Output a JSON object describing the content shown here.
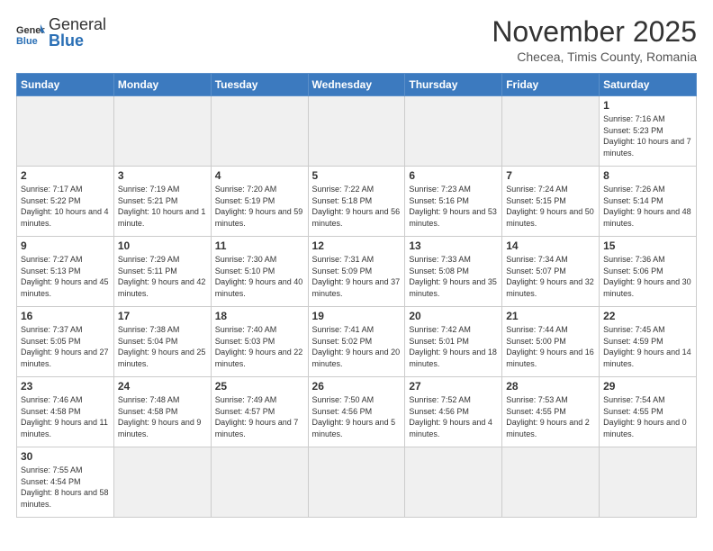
{
  "header": {
    "logo_general": "General",
    "logo_blue": "Blue",
    "month_title": "November 2025",
    "location": "Checea, Timis County, Romania"
  },
  "weekdays": [
    "Sunday",
    "Monday",
    "Tuesday",
    "Wednesday",
    "Thursday",
    "Friday",
    "Saturday"
  ],
  "weeks": [
    [
      {
        "day": "",
        "info": ""
      },
      {
        "day": "",
        "info": ""
      },
      {
        "day": "",
        "info": ""
      },
      {
        "day": "",
        "info": ""
      },
      {
        "day": "",
        "info": ""
      },
      {
        "day": "",
        "info": ""
      },
      {
        "day": "1",
        "info": "Sunrise: 7:16 AM\nSunset: 5:23 PM\nDaylight: 10 hours and 7 minutes."
      }
    ],
    [
      {
        "day": "2",
        "info": "Sunrise: 7:17 AM\nSunset: 5:22 PM\nDaylight: 10 hours and 4 minutes."
      },
      {
        "day": "3",
        "info": "Sunrise: 7:19 AM\nSunset: 5:21 PM\nDaylight: 10 hours and 1 minute."
      },
      {
        "day": "4",
        "info": "Sunrise: 7:20 AM\nSunset: 5:19 PM\nDaylight: 9 hours and 59 minutes."
      },
      {
        "day": "5",
        "info": "Sunrise: 7:22 AM\nSunset: 5:18 PM\nDaylight: 9 hours and 56 minutes."
      },
      {
        "day": "6",
        "info": "Sunrise: 7:23 AM\nSunset: 5:16 PM\nDaylight: 9 hours and 53 minutes."
      },
      {
        "day": "7",
        "info": "Sunrise: 7:24 AM\nSunset: 5:15 PM\nDaylight: 9 hours and 50 minutes."
      },
      {
        "day": "8",
        "info": "Sunrise: 7:26 AM\nSunset: 5:14 PM\nDaylight: 9 hours and 48 minutes."
      }
    ],
    [
      {
        "day": "9",
        "info": "Sunrise: 7:27 AM\nSunset: 5:13 PM\nDaylight: 9 hours and 45 minutes."
      },
      {
        "day": "10",
        "info": "Sunrise: 7:29 AM\nSunset: 5:11 PM\nDaylight: 9 hours and 42 minutes."
      },
      {
        "day": "11",
        "info": "Sunrise: 7:30 AM\nSunset: 5:10 PM\nDaylight: 9 hours and 40 minutes."
      },
      {
        "day": "12",
        "info": "Sunrise: 7:31 AM\nSunset: 5:09 PM\nDaylight: 9 hours and 37 minutes."
      },
      {
        "day": "13",
        "info": "Sunrise: 7:33 AM\nSunset: 5:08 PM\nDaylight: 9 hours and 35 minutes."
      },
      {
        "day": "14",
        "info": "Sunrise: 7:34 AM\nSunset: 5:07 PM\nDaylight: 9 hours and 32 minutes."
      },
      {
        "day": "15",
        "info": "Sunrise: 7:36 AM\nSunset: 5:06 PM\nDaylight: 9 hours and 30 minutes."
      }
    ],
    [
      {
        "day": "16",
        "info": "Sunrise: 7:37 AM\nSunset: 5:05 PM\nDaylight: 9 hours and 27 minutes."
      },
      {
        "day": "17",
        "info": "Sunrise: 7:38 AM\nSunset: 5:04 PM\nDaylight: 9 hours and 25 minutes."
      },
      {
        "day": "18",
        "info": "Sunrise: 7:40 AM\nSunset: 5:03 PM\nDaylight: 9 hours and 22 minutes."
      },
      {
        "day": "19",
        "info": "Sunrise: 7:41 AM\nSunset: 5:02 PM\nDaylight: 9 hours and 20 minutes."
      },
      {
        "day": "20",
        "info": "Sunrise: 7:42 AM\nSunset: 5:01 PM\nDaylight: 9 hours and 18 minutes."
      },
      {
        "day": "21",
        "info": "Sunrise: 7:44 AM\nSunset: 5:00 PM\nDaylight: 9 hours and 16 minutes."
      },
      {
        "day": "22",
        "info": "Sunrise: 7:45 AM\nSunset: 4:59 PM\nDaylight: 9 hours and 14 minutes."
      }
    ],
    [
      {
        "day": "23",
        "info": "Sunrise: 7:46 AM\nSunset: 4:58 PM\nDaylight: 9 hours and 11 minutes."
      },
      {
        "day": "24",
        "info": "Sunrise: 7:48 AM\nSunset: 4:58 PM\nDaylight: 9 hours and 9 minutes."
      },
      {
        "day": "25",
        "info": "Sunrise: 7:49 AM\nSunset: 4:57 PM\nDaylight: 9 hours and 7 minutes."
      },
      {
        "day": "26",
        "info": "Sunrise: 7:50 AM\nSunset: 4:56 PM\nDaylight: 9 hours and 5 minutes."
      },
      {
        "day": "27",
        "info": "Sunrise: 7:52 AM\nSunset: 4:56 PM\nDaylight: 9 hours and 4 minutes."
      },
      {
        "day": "28",
        "info": "Sunrise: 7:53 AM\nSunset: 4:55 PM\nDaylight: 9 hours and 2 minutes."
      },
      {
        "day": "29",
        "info": "Sunrise: 7:54 AM\nSunset: 4:55 PM\nDaylight: 9 hours and 0 minutes."
      }
    ],
    [
      {
        "day": "30",
        "info": "Sunrise: 7:55 AM\nSunset: 4:54 PM\nDaylight: 8 hours and 58 minutes."
      },
      {
        "day": "",
        "info": ""
      },
      {
        "day": "",
        "info": ""
      },
      {
        "day": "",
        "info": ""
      },
      {
        "day": "",
        "info": ""
      },
      {
        "day": "",
        "info": ""
      },
      {
        "day": "",
        "info": ""
      }
    ]
  ]
}
